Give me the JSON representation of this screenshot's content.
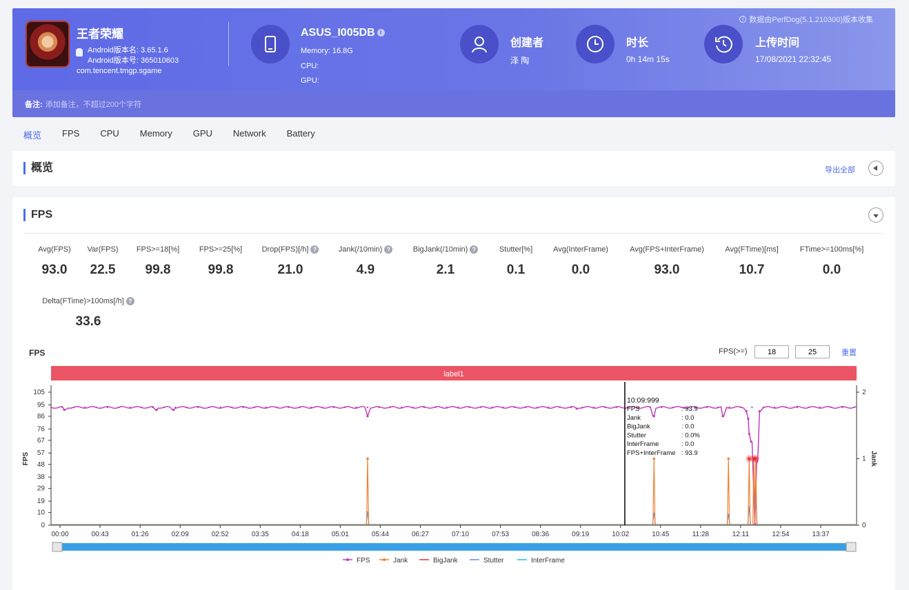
{
  "header": {
    "collect_note": "数据由PerfDog(5.1.210300)版本收集",
    "game_title": "王者荣耀",
    "android_version_name": "Android版本名: 3.65.1.6",
    "android_version_code": "Android版本号: 365010603",
    "package": "com.tencent.tmgp.sgame",
    "device_name": "ASUS_I005DB",
    "memory": "Memory: 16.8G",
    "cpu": "CPU:",
    "gpu": "GPU:",
    "creator_label": "创建者",
    "creator_value": "泽 陶",
    "duration_label": "时长",
    "duration_value": "0h 14m 15s",
    "upload_label": "上传时间",
    "upload_value": "17/08/2021 22:32:45",
    "note_label": "备注:",
    "note_placeholder": "添加备注，不超过200个字符"
  },
  "tabs": [
    "概览",
    "FPS",
    "CPU",
    "Memory",
    "GPU",
    "Network",
    "Battery"
  ],
  "active_tab": "概览",
  "overview": {
    "title": "概览",
    "export": "导出全部"
  },
  "fps_section": {
    "title": "FPS"
  },
  "metrics": [
    {
      "label": "Avg(FPS)",
      "value": "93.0",
      "help": false
    },
    {
      "label": "Var(FPS)",
      "value": "22.5",
      "help": false
    },
    {
      "label": "FPS>=18[%]",
      "value": "99.8",
      "help": false
    },
    {
      "label": "FPS>=25[%]",
      "value": "99.8",
      "help": false
    },
    {
      "label": "Drop(FPS)[/h]",
      "value": "21.0",
      "help": true
    },
    {
      "label": "Jank(/10min)",
      "value": "4.9",
      "help": true
    },
    {
      "label": "BigJank(/10min)",
      "value": "2.1",
      "help": true
    },
    {
      "label": "Stutter[%]",
      "value": "0.1",
      "help": false
    },
    {
      "label": "Avg(InterFrame)",
      "value": "0.0",
      "help": false
    },
    {
      "label": "Avg(FPS+InterFrame)",
      "value": "93.0",
      "help": false
    },
    {
      "label": "Avg(FTime)[ms]",
      "value": "10.7",
      "help": false
    },
    {
      "label": "FTime>=100ms[%]",
      "value": "0.0",
      "help": false
    },
    {
      "label": "Delta(FTime)>100ms[/h]",
      "value": "33.6",
      "help": true
    }
  ],
  "chart_controls": {
    "title": "FPS",
    "threshold_label": "FPS(>=)",
    "threshold1": "18",
    "threshold2": "25",
    "reset": "重置",
    "band_label": "label1"
  },
  "tooltip": {
    "time": "10:09:999",
    "rows": [
      [
        "FPS",
        ": 93.9"
      ],
      [
        "Jank",
        ": 0.0"
      ],
      [
        "BigJank",
        ": 0.0"
      ],
      [
        "Stutter",
        ": 0.0%"
      ],
      [
        "InterFrame",
        ": 0.0"
      ],
      [
        "FPS+InterFrame",
        ": 93.9"
      ]
    ]
  },
  "chart_data": {
    "type": "line",
    "ylabel": "FPS",
    "y2label": "Jank",
    "y_ticks": [
      0,
      10,
      19,
      29,
      38,
      48,
      57,
      67,
      76,
      86,
      95,
      105
    ],
    "y2_ticks": [
      0,
      1,
      2
    ],
    "ylim": [
      0,
      105
    ],
    "y2lim": [
      0,
      2
    ],
    "x_ticks": [
      "00:00",
      "00:43",
      "01:26",
      "02:09",
      "02:52",
      "03:35",
      "04:18",
      "05:01",
      "05:44",
      "06:27",
      "07:10",
      "07:53",
      "08:36",
      "09:19",
      "10:02",
      "10:45",
      "11:28",
      "12:11",
      "12:54",
      "13:37"
    ],
    "x_range_seconds": [
      0,
      855
    ],
    "series": [
      {
        "name": "FPS",
        "color": "#c040b8",
        "baseline": 93,
        "dips": [
          [
            14,
            91
          ],
          [
            112,
            91
          ],
          [
            130,
            91
          ],
          [
            336,
            86
          ],
          [
            558,
            92
          ],
          [
            640,
            86
          ],
          [
            713,
            86
          ],
          [
            738,
            90
          ],
          [
            740,
            84
          ],
          [
            741,
            72
          ],
          [
            743,
            66
          ],
          [
            747,
            1
          ],
          [
            749,
            50
          ],
          [
            752,
            90
          ]
        ]
      },
      {
        "name": "Jank",
        "color": "#f08030",
        "axis": "right",
        "spikes": [
          [
            336,
            1
          ],
          [
            640,
            1
          ],
          [
            719,
            1
          ],
          [
            741,
            1
          ],
          [
            746,
            1
          ],
          [
            748,
            1
          ]
        ]
      },
      {
        "name": "BigJank",
        "color": "#e83030",
        "axis": "right",
        "spikes": [
          [
            741,
            1
          ],
          [
            746,
            1
          ],
          [
            748,
            1
          ]
        ]
      },
      {
        "name": "Stutter",
        "color": "#5b8ef0",
        "spikes": [
          [
            336,
            11
          ],
          [
            640,
            10
          ],
          [
            719,
            9
          ],
          [
            741,
            15
          ],
          [
            748,
            22
          ]
        ]
      },
      {
        "name": "InterFrame",
        "color": "#20c0d8",
        "values": "all 0"
      }
    ],
    "cursor_time": "10:09:999",
    "cursor_seconds": 609,
    "legend_position": "bottom",
    "grid": false
  }
}
